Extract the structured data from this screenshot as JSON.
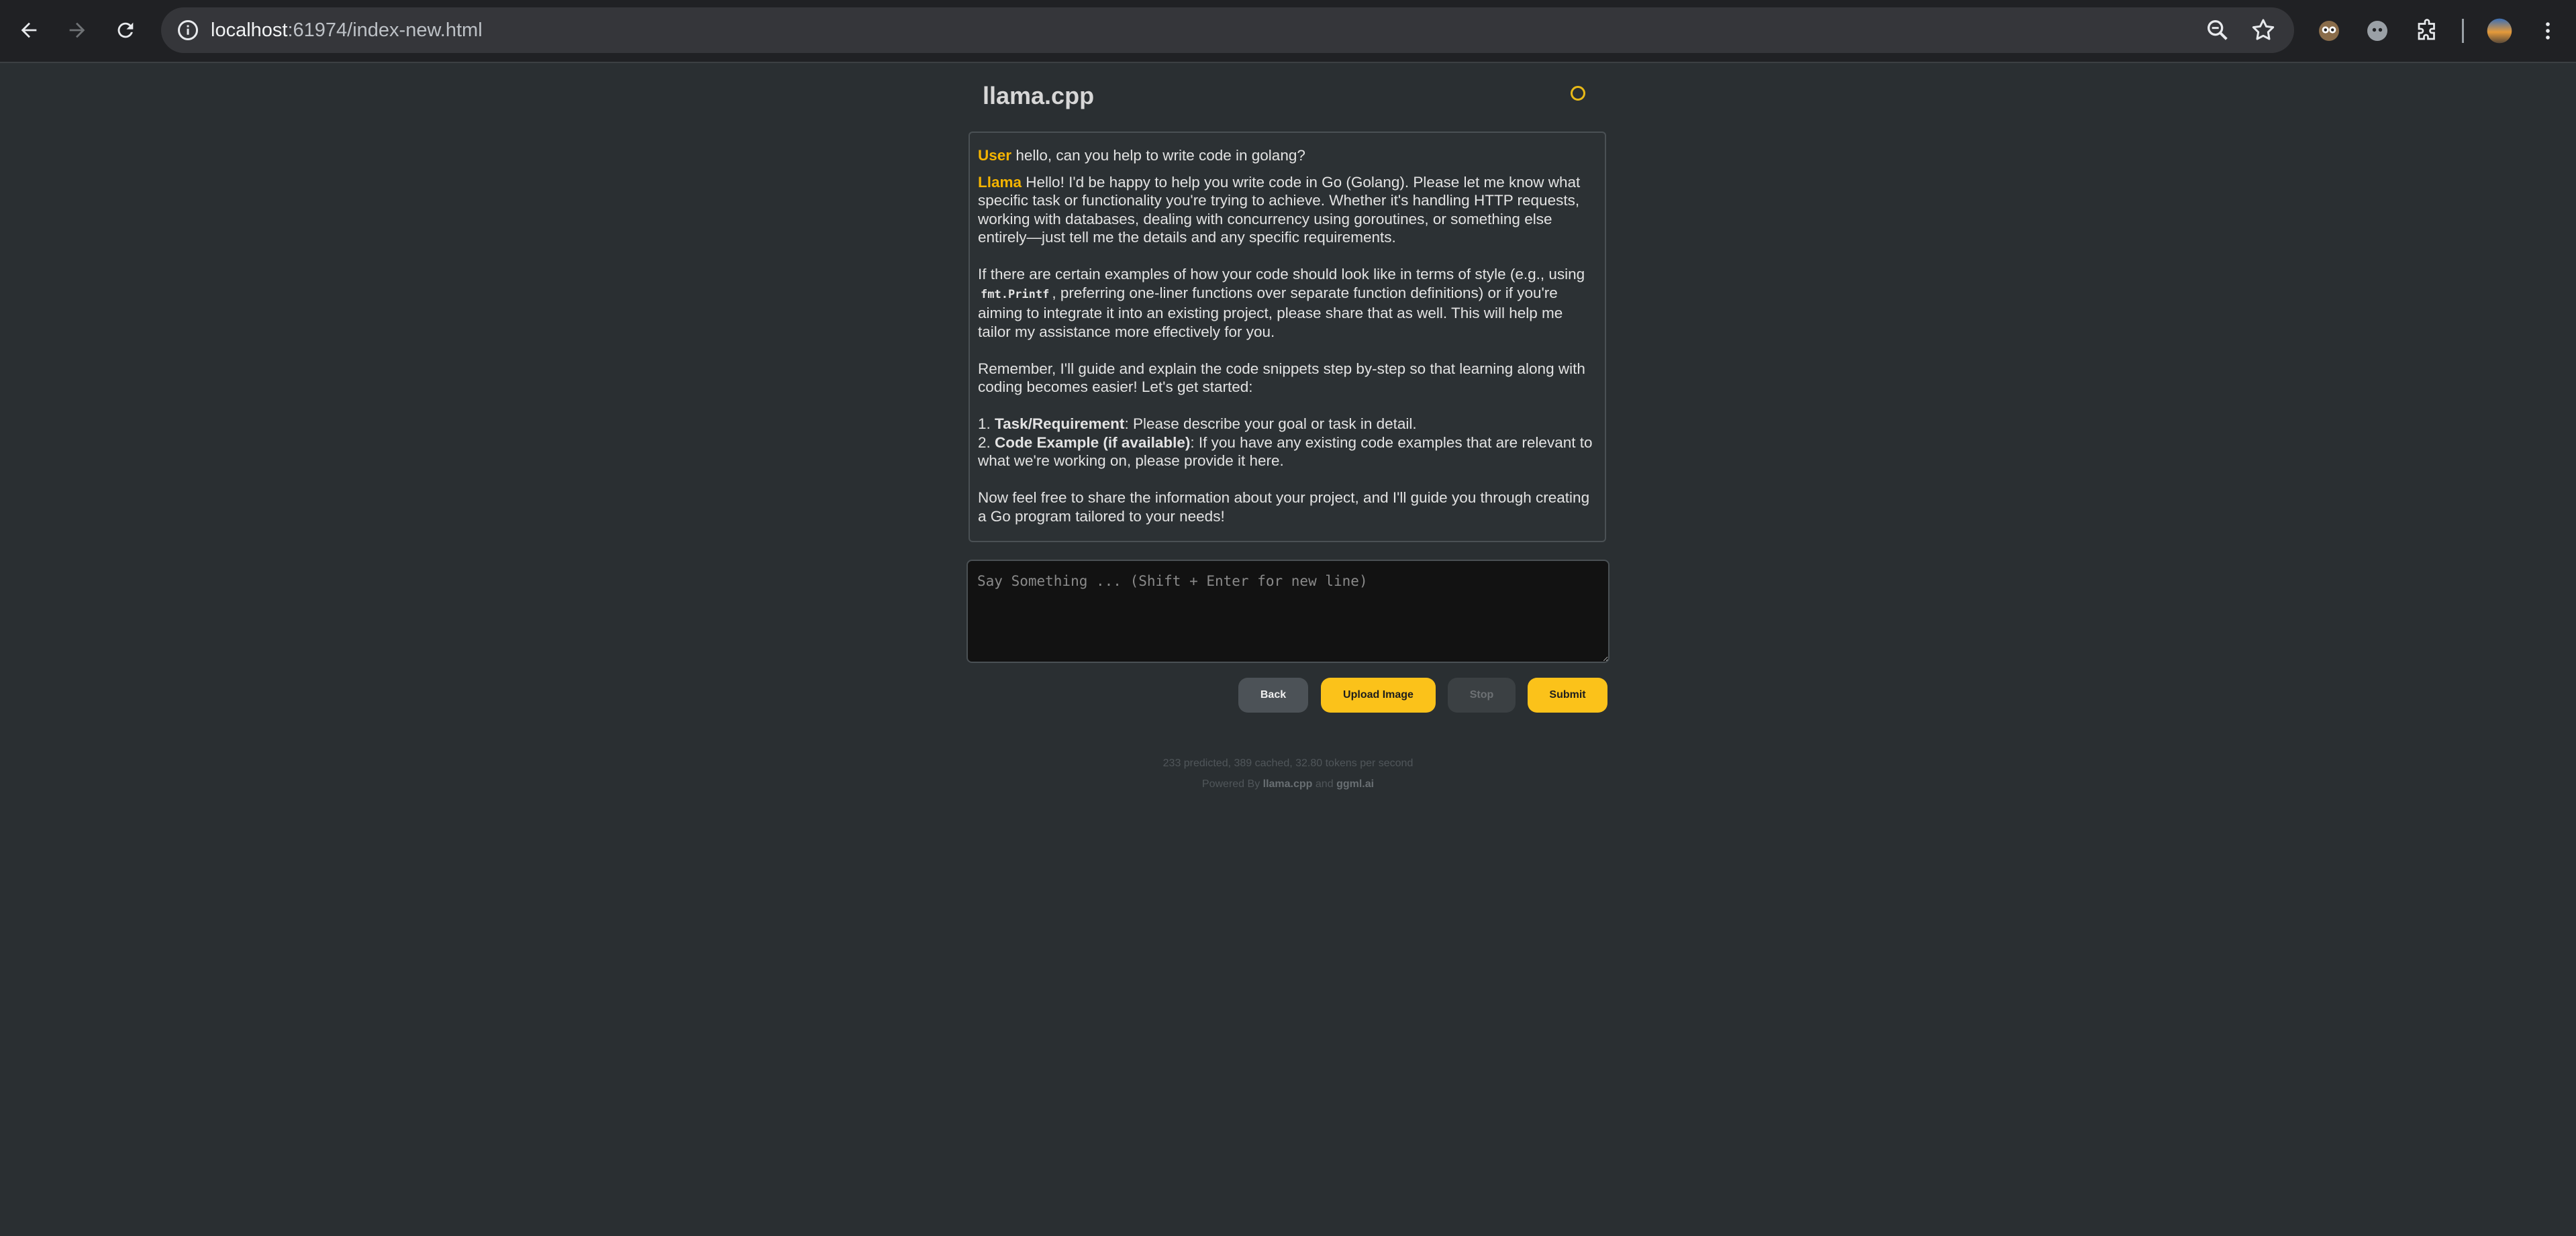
{
  "browser": {
    "url_host": "localhost",
    "url_rest": ":61974/index-new.html"
  },
  "app": {
    "title": "llama.cpp"
  },
  "chat": {
    "user_name": "User",
    "user_message": "hello, can you help to write code in golang?",
    "assistant_name": "Llama",
    "para1": "Hello! I'd be happy to help you write code in Go (Golang). Please let me know what specific task or functionality you're trying to achieve. Whether it's handling HTTP requests, working with databases, dealing with concurrency using goroutines, or something else entirely—just tell me the details and any specific requirements.",
    "para2_a": "If there are certain examples of how your code should look like in terms of style (e.g., using",
    "para2_code": "fmt.Printf",
    "para2_b": ", preferring one-liner functions over separate function definitions) or if you're aiming to integrate it into an existing project, please share that as well. This will help me tailor my assistance more effectively for you.",
    "para3": "Remember, I'll guide and explain the code snippets step by-step so that learning along with coding becomes easier! Let's get started:",
    "list1_num": "1.",
    "list1_bold": "Task/Requirement",
    "list1_rest": ": Please describe your goal or task in detail.",
    "list2_num": "2.",
    "list2_bold": "Code Example (if available)",
    "list2_rest": ": If you have any existing code examples that are relevant to what we're working on, please provide it here.",
    "para4": "Now feel free to share the information about your project, and I'll guide you through creating a Go program tailored to your needs!"
  },
  "input": {
    "placeholder": "Say Something ... (Shift + Enter for new line)",
    "value": ""
  },
  "buttons": {
    "back": "Back",
    "upload": "Upload Image",
    "stop": "Stop",
    "submit": "Submit"
  },
  "footer": {
    "stats": "233 predicted, 389 cached, 32.80 tokens per second",
    "powered_prefix": "Powered By",
    "powered_link1": "llama.cpp",
    "powered_and": "and",
    "powered_link2": "ggml.ai"
  },
  "colors": {
    "accent": "#fbc21a",
    "background": "#2a2f32"
  }
}
